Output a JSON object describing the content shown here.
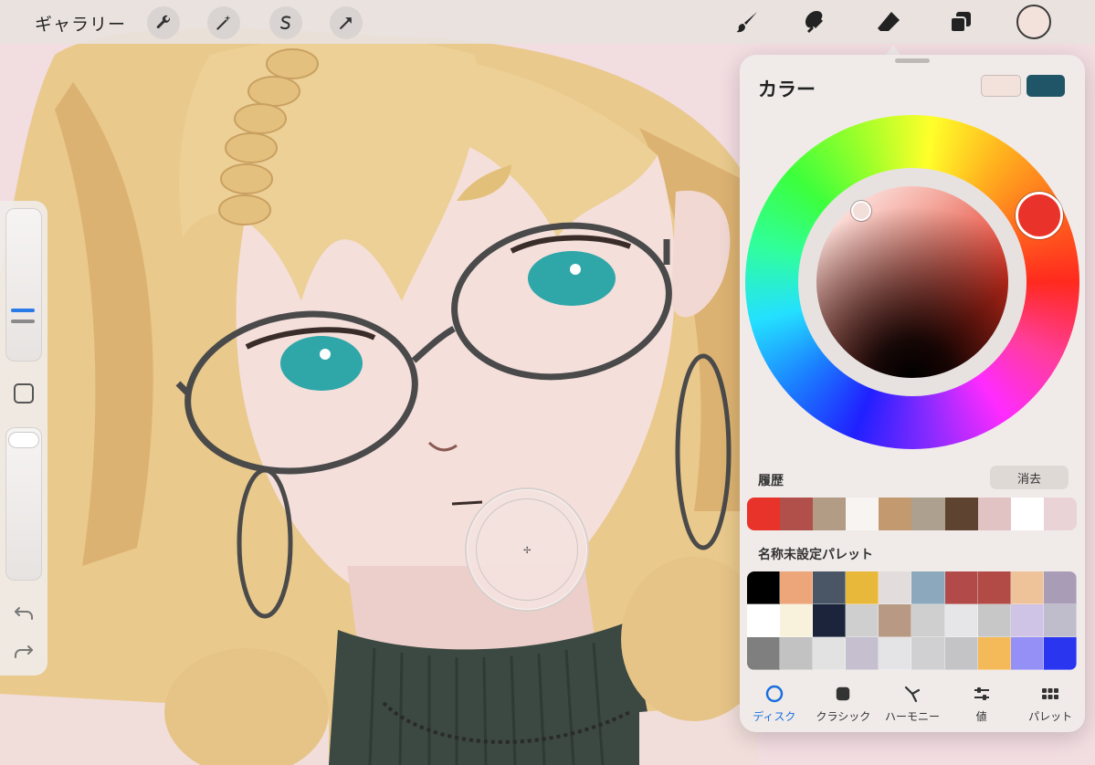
{
  "topbar": {
    "gallery_label": "ギャラリー"
  },
  "icons": {
    "left_tools": [
      "wrench-icon",
      "magic-wand-icon",
      "selection-icon",
      "transform-arrow-icon"
    ],
    "right_tools": [
      "brush-icon",
      "smudge-icon",
      "eraser-icon",
      "layers-icon"
    ]
  },
  "color_panel": {
    "title": "カラー",
    "primary_color": "#f3e1db",
    "secondary_color": "#1f5566",
    "hue_knob_color": "#e9322a",
    "history_label": "履歴",
    "clear_label": "消去",
    "history": [
      "#e8332a",
      "#b1504a",
      "#b39c86",
      "#f8f4f1",
      "#c39a6f",
      "#ada08f",
      "#5e4330",
      "#e1c3c3",
      "#ffffff",
      "#ead3d6"
    ],
    "palette_label": "名称未設定パレット",
    "palette": [
      "#000000",
      "#eda57a",
      "#4a5566",
      "#e8b83a",
      "#e2dcdc",
      "#8ca8bd",
      "#b14a48",
      "#b24a46",
      "#efc39a",
      "#a99cb6",
      "#ffffff",
      "#f8f1dc",
      "#1b243b",
      "#cfcfcf",
      "#b89a84",
      "#cfcfd0",
      "#e6e6e8",
      "#c7c7c8",
      "#cfc3e6",
      "#bfbccb",
      "#7f7f7f",
      "#c2c2c2",
      "#e2e2e3",
      "#c5bfcf",
      "#e4e4e6",
      "#d0cfd1",
      "#c4c4c6",
      "#f4ba5a",
      "#9490f5",
      "#2a35f0"
    ],
    "tabs": [
      {
        "label": "ディスク",
        "icon": "disc-icon",
        "active": true
      },
      {
        "label": "クラシック",
        "icon": "classic-square-icon",
        "active": false
      },
      {
        "label": "ハーモニー",
        "icon": "harmony-icon",
        "active": false
      },
      {
        "label": "値",
        "icon": "sliders-icon",
        "active": false
      },
      {
        "label": "パレット",
        "icon": "palette-grid-icon",
        "active": false
      }
    ]
  }
}
